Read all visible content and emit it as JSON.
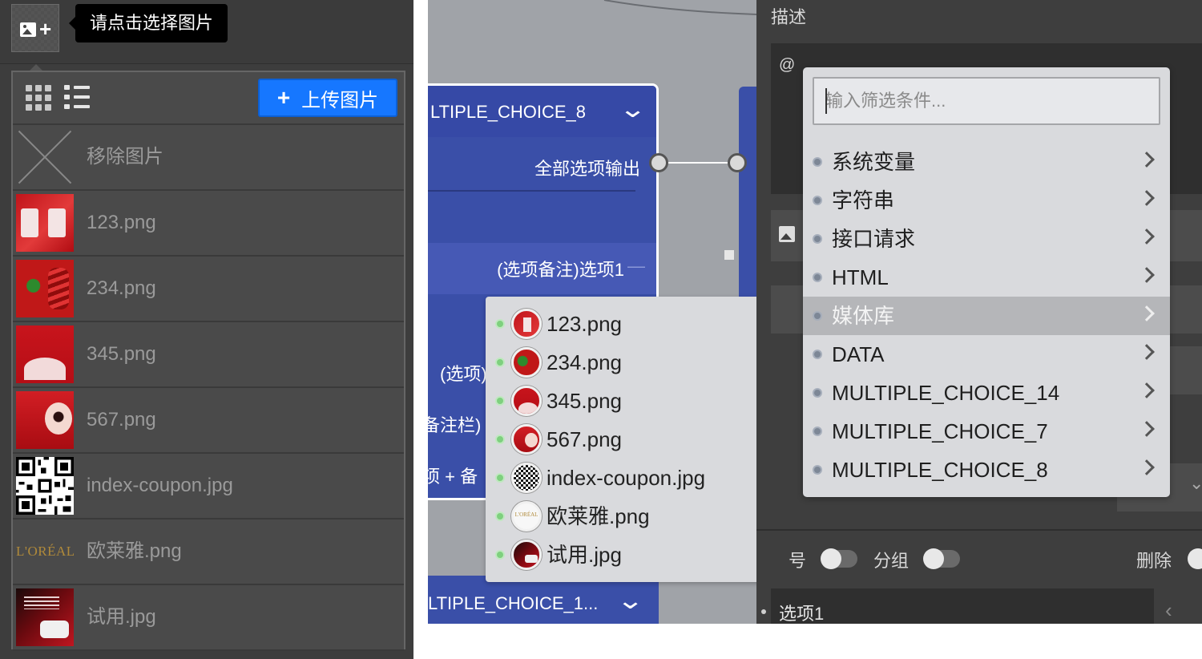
{
  "left": {
    "tooltip": "请点击选择图片",
    "upload_label": "上传图片",
    "remove_label": "移除图片",
    "files": [
      "123.png",
      "234.png",
      "345.png",
      "567.png",
      "index-coupon.jpg",
      "欧莱雅.png",
      "试用.jpg"
    ]
  },
  "canvas": {
    "node_a_title": "LTIPLE_CHOICE_8",
    "output_all_label": "全部选项输出",
    "option_note_label": "(选项备注)选项1",
    "option_note_dash": "—",
    "fragment_option": "(选项)",
    "fragment_note": "备注栏)",
    "fragment_plus_note": "项 + 备",
    "node_b_title": "LTIPLE_CHOICE_1..."
  },
  "media_submenu": {
    "items": [
      "123.png",
      "234.png",
      "345.png",
      "567.png",
      "index-coupon.jpg",
      "欧莱雅.png",
      "试用.jpg"
    ]
  },
  "right": {
    "desc_label": "描述",
    "desc_value": "@",
    "fragment_toggle": "号",
    "group_label": "分组",
    "delete_label": "删除",
    "option_value": "选项1"
  },
  "var_dropdown": {
    "filter_placeholder": "输入筛选条件...",
    "items": [
      "系统变量",
      "字符串",
      "接口请求",
      "HTML",
      "媒体库",
      "DATA",
      "MULTIPLE_CHOICE_14",
      "MULTIPLE_CHOICE_7",
      "MULTIPLE_CHOICE_8"
    ],
    "active_item": "媒体库"
  },
  "colors": {
    "upload_button": "#1677ff",
    "node_blue": "#3a4fa8",
    "menu_bg": "#d9dadd",
    "status_green": "#7ed07e"
  }
}
